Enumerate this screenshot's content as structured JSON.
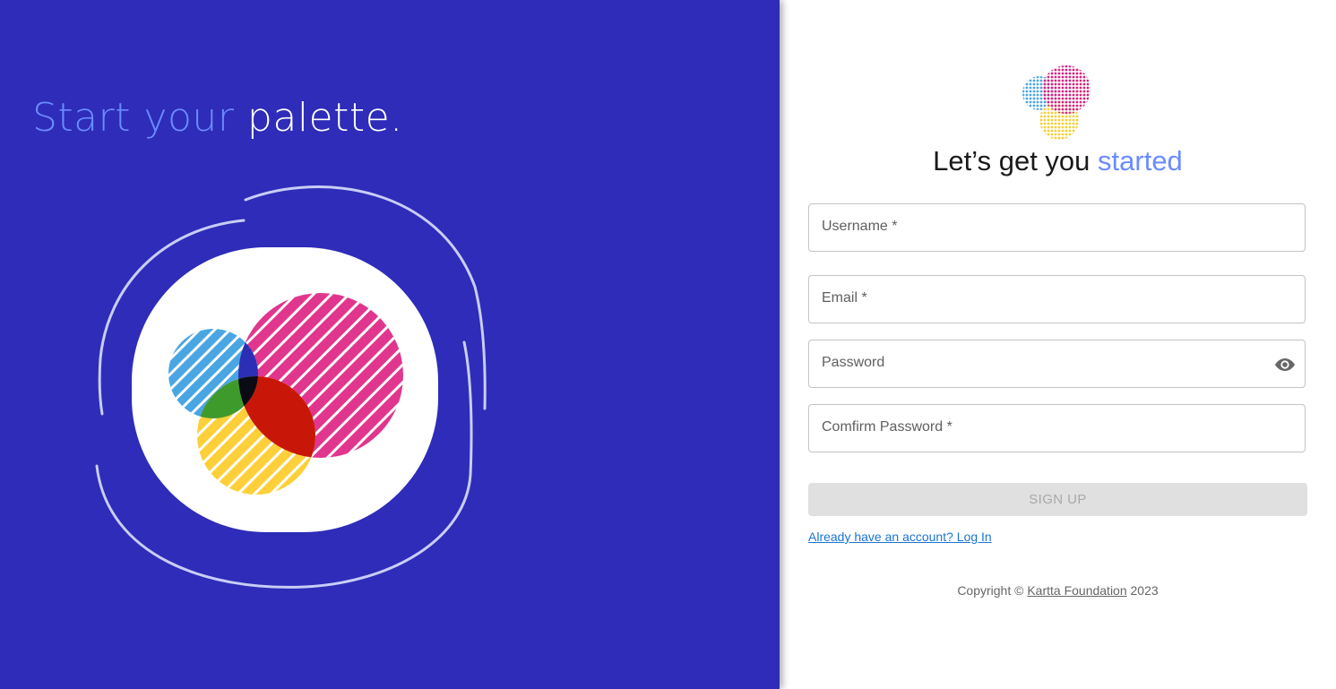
{
  "hero": {
    "title_accent": "Start your",
    "title_plain": "palette."
  },
  "form": {
    "heading_plain": "Let’s get you",
    "heading_accent": "started",
    "username_label": "Username *",
    "email_label": "Email *",
    "password_label": "Password",
    "confirm_password_label": "Comfirm Password *",
    "signup_label": "SIGN UP",
    "login_link": "Already have an account? Log In"
  },
  "footer": {
    "copyright_prefix": "Copyright ©",
    "org_name": "Kartta Foundation",
    "year": "2023"
  },
  "icons": {
    "password_toggle": "eye-icon",
    "logo": "palette-logo-icon"
  },
  "colors": {
    "left_background": "#2e2cb8",
    "accent": "#6a8cff",
    "link": "#1a75d2",
    "disabled_button": "#e0e0e0"
  }
}
